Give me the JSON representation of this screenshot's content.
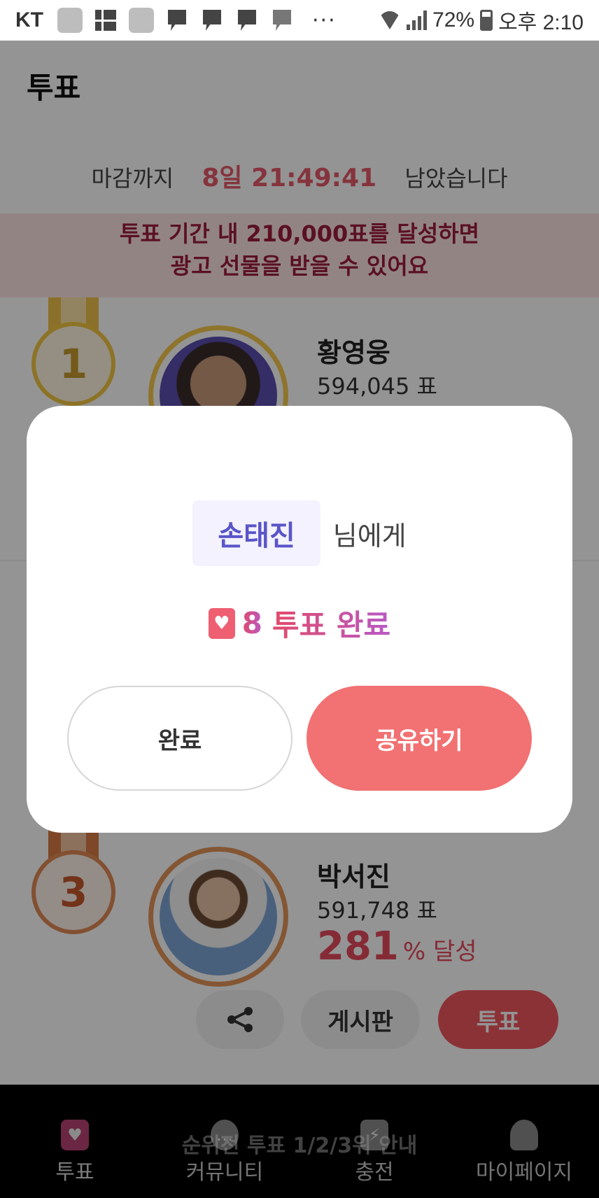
{
  "status_bar": {
    "carrier": "KT",
    "battery": "72%",
    "time": "오후 2:10",
    "more": "···"
  },
  "header": {
    "title": "투표"
  },
  "countdown": {
    "prefix": "마감까지",
    "time": "8일 21:49:41",
    "suffix": "남았습니다"
  },
  "banner": {
    "line1": "투표 기간 내 210,000표를 달성하면",
    "line2": "광고 선물을 받을 수 있어요"
  },
  "ranking": [
    {
      "rank": "1",
      "name": "황영웅",
      "votes": "594,045 표"
    },
    {
      "rank": "3",
      "name": "박서진",
      "votes": "591,748 표",
      "percent": "281",
      "percent_unit": "% 달성"
    }
  ],
  "row_actions": {
    "board": "게시판",
    "vote": "투표"
  },
  "modal": {
    "recipient": "손태진",
    "recipient_suffix": "님에게",
    "vote_count": "8",
    "result_text": "투표 완료",
    "done_button": "완료",
    "share_button": "공유하기"
  },
  "notice": "순위전 투표 1/2/3위 안내",
  "bottom_nav": [
    {
      "label": "투표"
    },
    {
      "label": "커뮤니티"
    },
    {
      "label": "충전"
    },
    {
      "label": "마이페이지"
    }
  ],
  "colors": {
    "accent": "#f27172",
    "highlight_red": "#e64b5e",
    "recipient_purple": "#5a55c8",
    "banner_bg": "#fde4e3"
  }
}
